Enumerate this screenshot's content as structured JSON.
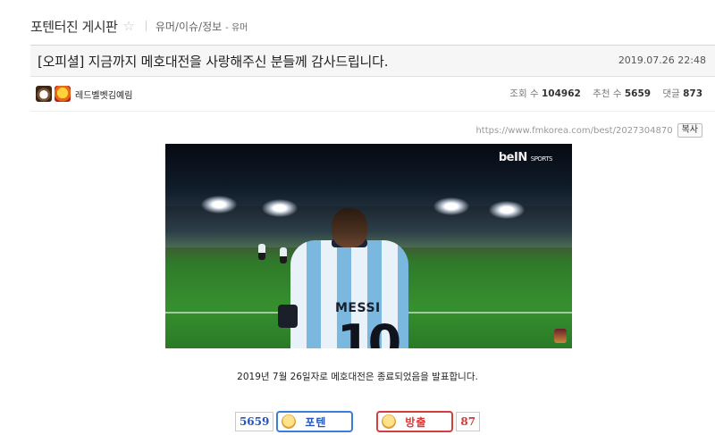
{
  "board": {
    "title": "포텐터진 게시판",
    "favorite_icon": "star-icon",
    "category": "유머/이슈/정보",
    "subcategory": "- 유머"
  },
  "post": {
    "title": "[오피셜] 지금까지 메호대전을 사랑해주신 분들께 감사드립니다.",
    "date": "2019.07.26 22:48",
    "author": "레드벨벳김예림",
    "views_label": "조회 수",
    "views": "104962",
    "recommend_label": "추천 수",
    "recommend": "5659",
    "comments_label": "댓글",
    "comments": "873",
    "url": "https://www.fmkorea.com/best/2027304870",
    "copy_label": "복사",
    "caption": "2019년 7월 26일자로 메호대전은 종료되었음을 발표합니다.",
    "gif": {
      "shirt_name": "MESSI",
      "shirt_number": "10",
      "broadcaster": "beIN",
      "broadcaster_sub": "SPORTS"
    }
  },
  "vote": {
    "up_count": "5659",
    "up_label": "포텐",
    "down_label": "방출",
    "down_count": "87"
  },
  "colors": {
    "up": "#3b7dd8",
    "down": "#d93a3a"
  }
}
